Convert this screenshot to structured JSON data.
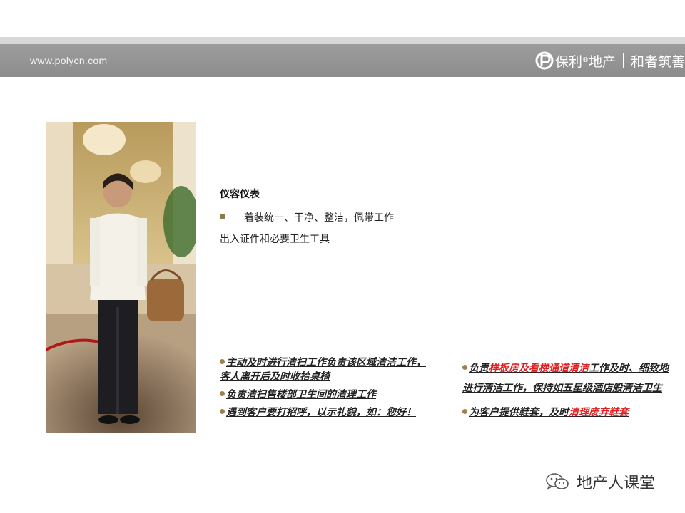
{
  "header": {
    "site_url": "www.polycn.com",
    "brand_name": "保利",
    "brand_mark": "®",
    "brand_suffix": "地产",
    "slogan": "和者筑善"
  },
  "photo": {
    "subject": "staff-photo"
  },
  "section": {
    "title": "仪容仪表",
    "intro": "着装统一、干净、整洁，佩带工作出入证件和必要卫生工具"
  },
  "duties_left": [
    "主动及时进行清扫工作负责该区域清洁工作，客人离开后及时收拾桌椅",
    "负责清扫售楼部卫生间的清理工作",
    "遇到客户要打招呼，以示礼貌，如：您好！"
  ],
  "duties_right": {
    "item1": {
      "p1": "负责",
      "p2": "样板房及看楼通道清洁",
      "p3": "工作及时、细致地进行清洁工作，保持如五星级酒店般清洁卫生"
    },
    "item2": {
      "p1": "为客户提供鞋套，及时",
      "p2": "清理废弃鞋套"
    }
  },
  "footer": {
    "account": "地产人课堂"
  },
  "colors": {
    "header_bar": "#8c8c8c",
    "bullet": "#a0804a",
    "highlight": "#e02020"
  }
}
